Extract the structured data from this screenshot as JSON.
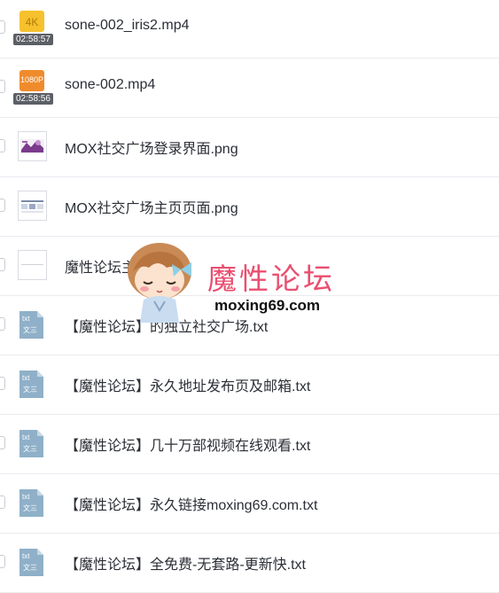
{
  "files": [
    {
      "name": "sone-002_iris2.mp4",
      "kind": "video",
      "quality": "4K",
      "duration": "02:58:57"
    },
    {
      "name": "sone-002.mp4",
      "kind": "video",
      "quality": "1080P",
      "duration": "02:58:56"
    },
    {
      "name": "MOX社交广场登录界面.png",
      "kind": "image"
    },
    {
      "name": "MOX社交广场主页页面.png",
      "kind": "image"
    },
    {
      "name": "魔性论坛主页.png",
      "kind": "image"
    },
    {
      "name": "【魔性论坛】的独立社交广场.txt",
      "kind": "txt"
    },
    {
      "name": "【魔性论坛】永久地址发布页及邮箱.txt",
      "kind": "txt"
    },
    {
      "name": "【魔性论坛】几十万部视频在线观看.txt",
      "kind": "txt"
    },
    {
      "name": "【魔性论坛】永久链接moxing69.com.txt",
      "kind": "txt"
    },
    {
      "name": "【魔性论坛】全免费-无套路-更新快.txt",
      "kind": "txt"
    }
  ],
  "txt_icon": {
    "top": "txt",
    "bottom": "文三"
  },
  "watermark": {
    "title": "魔性论坛",
    "url": "moxing69.com"
  },
  "colors": {
    "video_4k": "#f6c12d",
    "video_1080": "#f08b2c",
    "txt_icon": "#8fb0c8",
    "watermark_pink": "#e94f70"
  }
}
